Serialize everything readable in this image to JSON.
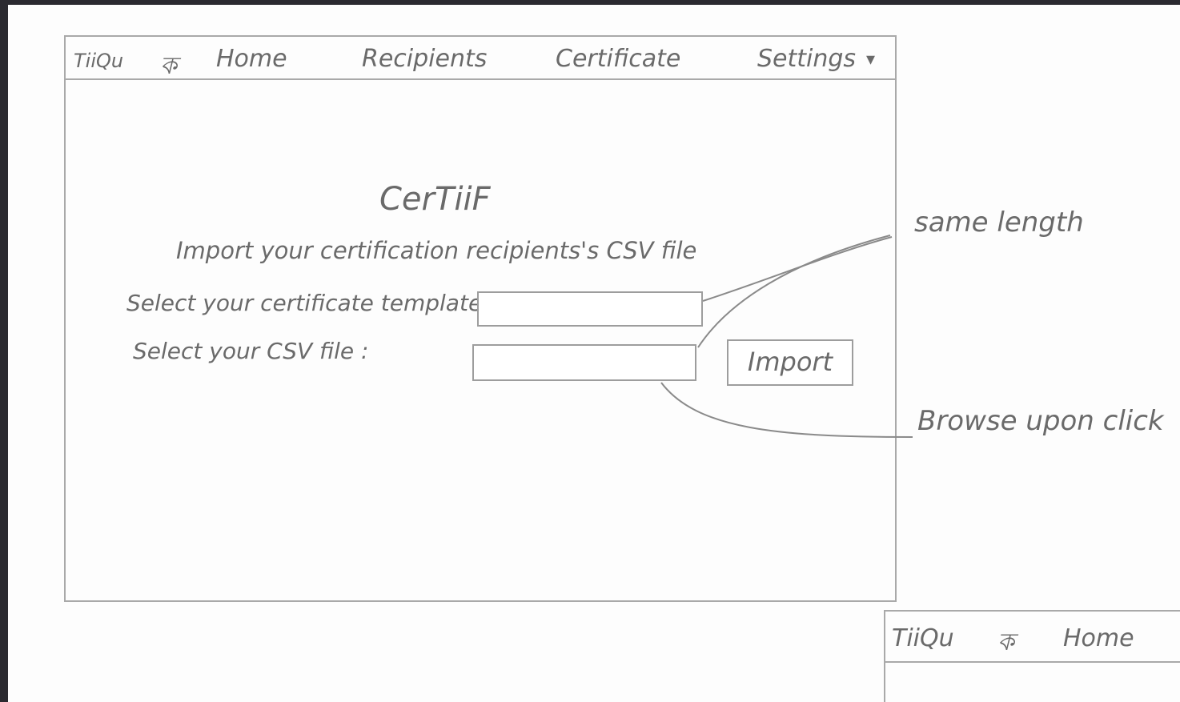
{
  "top_nav": {
    "logo": "TiiQu",
    "logo_glyph": "ক",
    "items": [
      {
        "label": "Home"
      },
      {
        "label": "Recipients"
      },
      {
        "label": "Certificate"
      },
      {
        "label": "Settings"
      }
    ],
    "dropdown_glyph": "▾"
  },
  "main": {
    "title": "CerTiiF",
    "subtitle": "Import your certification recipients's CSV file",
    "template_label": "Select your certificate template:",
    "csv_label": "Select your CSV file :",
    "import_button": "Import"
  },
  "annotations": {
    "same_length": "same length",
    "browse": "Browse upon click"
  },
  "second_frame": {
    "logo": "TiiQu",
    "logo_glyph": "ক",
    "home": "Home"
  }
}
